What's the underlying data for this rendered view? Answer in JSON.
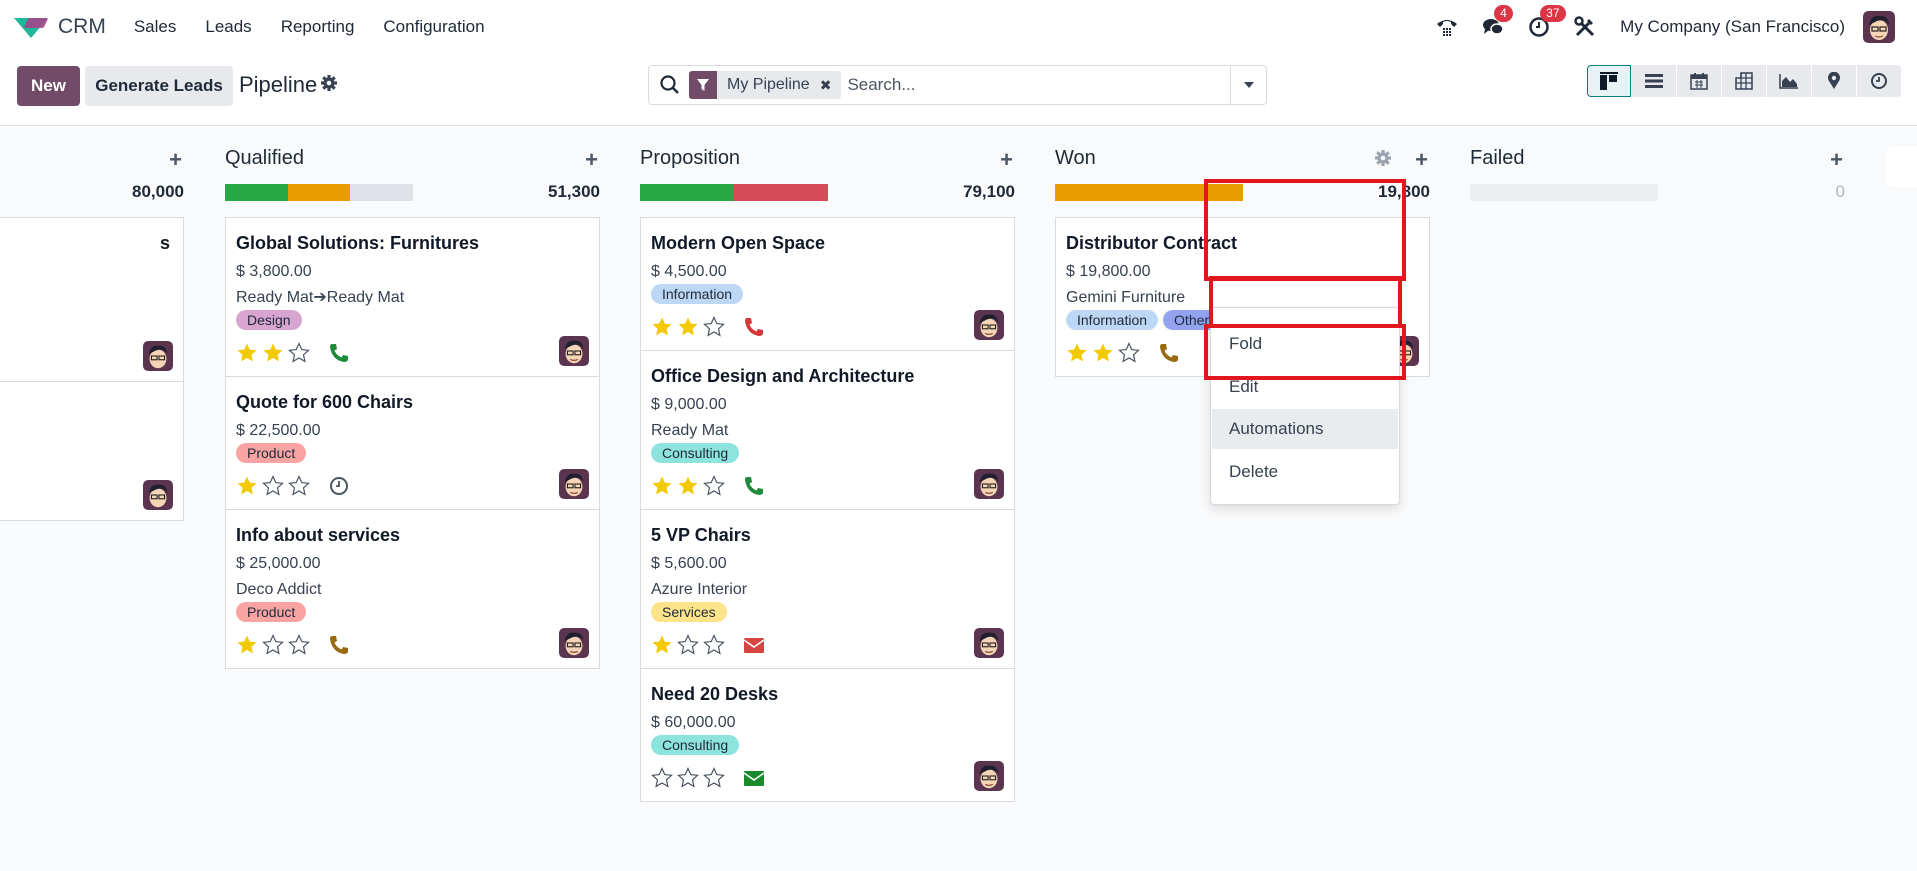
{
  "navbar": {
    "app_name": "CRM",
    "menu": [
      "Sales",
      "Leads",
      "Reporting",
      "Configuration"
    ],
    "messages_count": "4",
    "activities_count": "37",
    "company": "My Company (San Francisco)"
  },
  "control": {
    "new_label": "New",
    "generate_label": "Generate Leads",
    "title": "Pipeline",
    "search_facet": "My Pipeline",
    "search_placeholder": "Search...",
    "views": [
      "kanban",
      "list",
      "calendar",
      "pivot",
      "graph",
      "map",
      "activity"
    ],
    "active_view": "kanban"
  },
  "colors": {
    "brand": "#714b67",
    "green": "#28a745",
    "orange": "#e99d00",
    "red": "#d44c59",
    "grey": "#dee2e6",
    "highlight": "#e3161f"
  },
  "columns": [
    {
      "title": "",
      "total": "80,000",
      "cards": [
        {
          "title": "s",
          "amount": "",
          "partner": "",
          "tags": [],
          "stars": 0,
          "activity": "none"
        },
        {
          "title": "",
          "amount": "",
          "partner": "",
          "tags": [],
          "stars": 0,
          "activity": "none"
        }
      ]
    },
    {
      "title": "Qualified",
      "total": "51,300",
      "progress": [
        {
          "color": "#28a745",
          "pct": 33.3
        },
        {
          "color": "#e99d00",
          "pct": 33.3
        }
      ],
      "cards": [
        {
          "title": "Global Solutions: Furnitures",
          "amount": "$ 3,800.00",
          "partner": "Ready Mat➔Ready Mat",
          "tags": [
            {
              "label": "Design",
              "color": "#d8a5d1"
            }
          ],
          "stars": 2,
          "activity": "phone-green"
        },
        {
          "title": "Quote for 600 Chairs",
          "amount": "$ 22,500.00",
          "partner": "",
          "tags": [
            {
              "label": "Product",
              "color": "#f9a3a3"
            }
          ],
          "stars": 1,
          "activity": "clock"
        },
        {
          "title": "Info about services",
          "amount": "$ 25,000.00",
          "partner": "Deco Addict",
          "tags": [
            {
              "label": "Product",
              "color": "#f9a3a3"
            }
          ],
          "stars": 1,
          "activity": "phone-orange"
        }
      ]
    },
    {
      "title": "Proposition",
      "total": "79,100",
      "progress": [
        {
          "color": "#28a745",
          "pct": 50
        },
        {
          "color": "#d44c59",
          "pct": 50
        }
      ],
      "cards": [
        {
          "title": "Modern Open Space",
          "amount": "$ 4,500.00",
          "partner": "",
          "tags": [
            {
              "label": "Information",
              "color": "#bdd7f5"
            }
          ],
          "stars": 2,
          "activity": "phone-red"
        },
        {
          "title": "Office Design and Architecture",
          "amount": "$ 9,000.00",
          "partner": "Ready Mat",
          "tags": [
            {
              "label": "Consulting",
              "color": "#8de3dd"
            }
          ],
          "stars": 2,
          "activity": "phone-green"
        },
        {
          "title": "5 VP Chairs",
          "amount": "$ 5,600.00",
          "partner": "Azure Interior",
          "tags": [
            {
              "label": "Services",
              "color": "#fde48a"
            }
          ],
          "stars": 1,
          "activity": "mail-red"
        },
        {
          "title": "Need 20 Desks",
          "amount": "$ 60,000.00",
          "partner": "",
          "tags": [
            {
              "label": "Consulting",
              "color": "#8de3dd"
            }
          ],
          "stars": 0,
          "activity": "mail-green"
        }
      ]
    },
    {
      "title": "Won",
      "total": "19,800",
      "progress": [
        {
          "color": "#e99d00",
          "pct": 100
        }
      ],
      "cards": [
        {
          "title": "Distributor Contract",
          "amount": "$ 19,800.00",
          "partner": "Gemini Furniture",
          "tags": [
            {
              "label": "Information",
              "color": "#bdd7f5"
            },
            {
              "label": "Other",
              "color": "#93a3f0"
            }
          ],
          "stars": 2,
          "activity": "phone-orange"
        }
      ]
    },
    {
      "title": "Failed",
      "total": "0",
      "progress": [],
      "cards": []
    }
  ],
  "column_menu": {
    "items": [
      "Fold",
      "Edit",
      "Automations",
      "Delete"
    ],
    "hovered": "Automations"
  }
}
